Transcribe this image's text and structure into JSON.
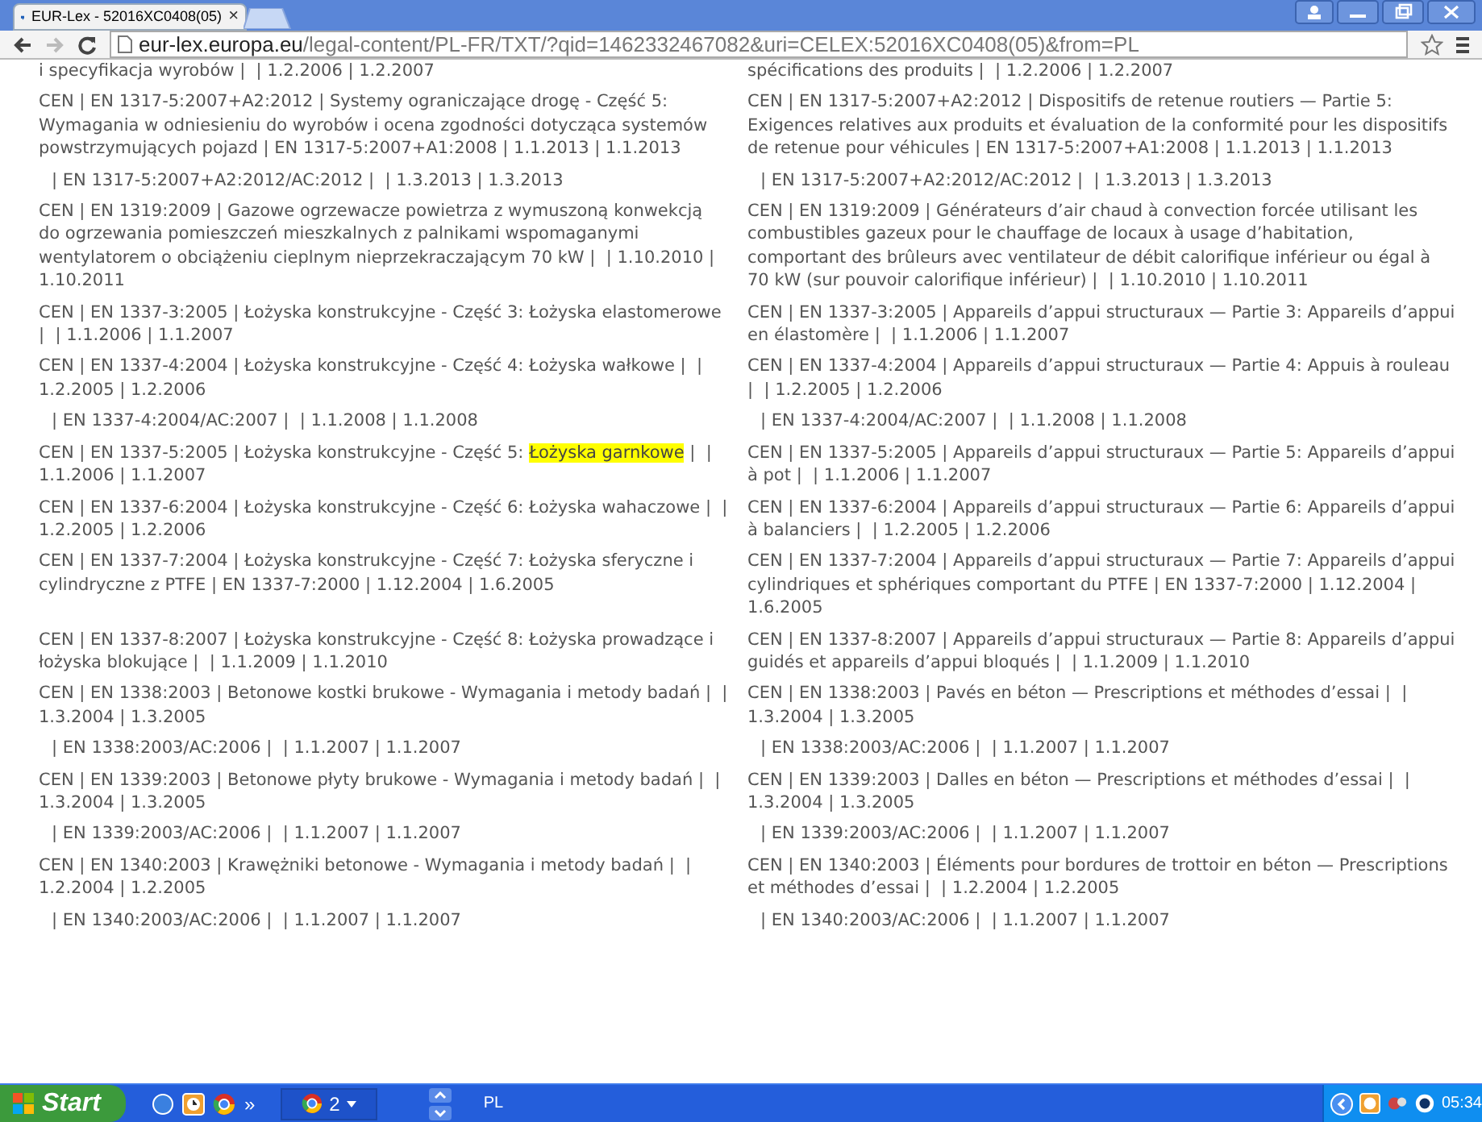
{
  "browser": {
    "tab": {
      "title": "EUR-Lex - 52016XC0408(05)",
      "close": "×",
      "selected": true
    },
    "address": {
      "host": "eur-lex.europa.eu",
      "path": "/legal-content/PL-FR/TXT/?qid=1462332467082&uri=CELEX:52016XC0408(05)&from=PL"
    }
  },
  "rows": [
    {
      "pl": [
        {
          "text": "i specyfikacja wyrobów |  | 1.2.2006 | 1.2.2007",
          "highlighted": false
        }
      ],
      "fr": [
        {
          "text": "spécifications des produits |  | 1.2.2006 | 1.2.2007",
          "highlighted": false
        }
      ]
    },
    {
      "pl": [
        {
          "text": "CEN | EN 1317-5:2007+A2:2012 | Systemy ograniczające drogę - Część 5: Wymagania w odniesieniu do wyrobów i ocena zgodności dotycząca systemów powstrzymujących pojazd | EN 1317-5:2007+A1:2008 | 1.1.2013 | 1.1.2013",
          "highlighted": false
        }
      ],
      "fr": [
        {
          "text": "CEN | EN 1317-5:2007+A2:2012 | Dispositifs de retenue routiers — Partie 5: Exigences relatives aux produits et évaluation de la conformité pour les dispositifs de retenue pour véhicules | EN 1317-5:2007+A1:2008 | 1.1.2013 | 1.1.2013",
          "highlighted": false
        }
      ]
    },
    {
      "pl": [
        {
          "text": "| EN 1317-5:2007+A2:2012/AC:2012 |  | 1.3.2013 | 1.3.2013",
          "highlighted": false
        }
      ],
      "fr": [
        {
          "text": "| EN 1317-5:2007+A2:2012/AC:2012 |  | 1.3.2013 | 1.3.2013",
          "highlighted": false
        }
      ],
      "indent": true
    },
    {
      "pl": [
        {
          "text": "CEN | EN 1319:2009 | Gazowe ogrzewacze powietrza z wymuszoną konwekcją do ogrzewania pomieszczeń mieszkalnych z palnikami wspomaganymi wentylatorem o obciążeniu cieplnym nieprzekraczającym 70 kW |  | 1.10.2010 | 1.10.2011",
          "highlighted": false
        }
      ],
      "fr": [
        {
          "text": "CEN | EN 1319:2009 | Générateurs d’air chaud à convection forcée utilisant les combustibles gazeux pour le chauffage de locaux à usage d’habitation, comportant des brûleurs avec ventilateur de débit calorifique inférieur ou égal à 70 kW (sur pouvoir calorifique inférieur) |  | 1.10.2010 | 1.10.2011",
          "highlighted": false
        }
      ]
    },
    {
      "pl": [
        {
          "text": "CEN | EN 1337-3:2005 | Łożyska konstrukcyjne - Część 3: Łożyska elastomerowe |  | 1.1.2006 | 1.1.2007",
          "highlighted": false
        }
      ],
      "fr": [
        {
          "text": "CEN | EN 1337-3:2005 | Appareils d’appui structuraux — Partie 3: Appareils d’appui en élastomère |  | 1.1.2006 | 1.1.2007",
          "highlighted": false
        }
      ]
    },
    {
      "pl": [
        {
          "text": "CEN | EN 1337-4:2004 | Łożyska konstrukcyjne - Część 4: Łożyska wałkowe |  | 1.2.2005 | 1.2.2006",
          "highlighted": false
        }
      ],
      "fr": [
        {
          "text": "CEN | EN 1337-4:2004 | Appareils d’appui structuraux — Partie 4: Appuis à rouleau |  | 1.2.2005 | 1.2.2006",
          "highlighted": false
        }
      ]
    },
    {
      "pl": [
        {
          "text": "| EN 1337-4:2004/AC:2007 |  | 1.1.2008 | 1.1.2008",
          "highlighted": false
        }
      ],
      "fr": [
        {
          "text": "| EN 1337-4:2004/AC:2007 |  | 1.1.2008 | 1.1.2008",
          "highlighted": false
        }
      ],
      "indent": true
    },
    {
      "pl": [
        {
          "text": "CEN | EN 1337-5:2005 | Łożyska konstrukcyjne - Część 5: ",
          "highlighted": false
        },
        {
          "text": "Łożyska garnkowe",
          "highlighted": true
        },
        {
          "text": " |  | 1.1.2006 | 1.1.2007",
          "highlighted": false
        }
      ],
      "fr": [
        {
          "text": "CEN | EN 1337-5:2005 | Appareils d’appui structuraux — Partie 5: Appareils d’appui à pot |  | 1.1.2006 | 1.1.2007",
          "highlighted": false
        }
      ]
    },
    {
      "pl": [
        {
          "text": "CEN | EN 1337-6:2004 | Łożyska konstrukcyjne - Część 6: Łożyska wahaczowe |  | 1.2.2005 | 1.2.2006",
          "highlighted": false
        }
      ],
      "fr": [
        {
          "text": "CEN | EN 1337-6:2004 | Appareils d’appui structuraux — Partie 6: Appareils d’appui à balanciers |  | 1.2.2005 | 1.2.2006",
          "highlighted": false
        }
      ]
    },
    {
      "pl": [
        {
          "text": "CEN | EN 1337-7:2004 | Łożyska konstrukcyjne - Część 7: Łożyska sferyczne i cylindryczne z PTFE | EN 1337-7:2000 | 1.12.2004 | 1.6.2005",
          "highlighted": false
        }
      ],
      "fr": [
        {
          "text": "CEN | EN 1337-7:2004 | Appareils d’appui structuraux — Partie 7: Appareils d’appui cylindriques et sphériques comportant du PTFE | EN 1337-7:2000 | 1.12.2004 | 1.6.2005",
          "highlighted": false
        }
      ]
    },
    {
      "pl": [
        {
          "text": "CEN | EN 1337-8:2007 | Łożyska konstrukcyjne - Część 8: Łożyska prowadzące i łożyska blokujące |  | 1.1.2009 | 1.1.2010",
          "highlighted": false
        }
      ],
      "fr": [
        {
          "text": "CEN | EN 1337-8:2007 | Appareils d’appui structuraux — Partie 8: Appareils d’appui guidés et appareils d’appui bloqués |  | 1.1.2009 | 1.1.2010",
          "highlighted": false
        }
      ]
    },
    {
      "pl": [
        {
          "text": "CEN | EN 1338:2003 | Betonowe kostki brukowe - Wymagania i metody badań |  | 1.3.2004 | 1.3.2005",
          "highlighted": false
        }
      ],
      "fr": [
        {
          "text": "CEN | EN 1338:2003 | Pavés en béton — Prescriptions et méthodes d’essai |  | 1.3.2004 | 1.3.2005",
          "highlighted": false
        }
      ]
    },
    {
      "pl": [
        {
          "text": "| EN 1338:2003/AC:2006 |  | 1.1.2007 | 1.1.2007",
          "highlighted": false
        }
      ],
      "fr": [
        {
          "text": "| EN 1338:2003/AC:2006 |  | 1.1.2007 | 1.1.2007",
          "highlighted": false
        }
      ],
      "indent": true
    },
    {
      "pl": [
        {
          "text": "CEN | EN 1339:2003 | Betonowe płyty brukowe - Wymagania i metody badań |  | 1.3.2004 | 1.3.2005",
          "highlighted": false
        }
      ],
      "fr": [
        {
          "text": "CEN | EN 1339:2003 | Dalles en béton — Prescriptions et méthodes d’essai |  | 1.3.2004 | 1.3.2005",
          "highlighted": false
        }
      ]
    },
    {
      "pl": [
        {
          "text": "| EN 1339:2003/AC:2006 |  | 1.1.2007 | 1.1.2007",
          "highlighted": false
        }
      ],
      "fr": [
        {
          "text": "| EN 1339:2003/AC:2006 |  | 1.1.2007 | 1.1.2007",
          "highlighted": false
        }
      ],
      "indent": true
    },
    {
      "pl": [
        {
          "text": "CEN | EN 1340:2003 | Krawężniki betonowe - Wymagania i metody badań |  | 1.2.2004 | 1.2.2005",
          "highlighted": false
        }
      ],
      "fr": [
        {
          "text": "CEN | EN 1340:2003 | Éléments pour bordures de trottoir en béton — Prescriptions et méthodes d’essai |  | 1.2.2004 | 1.2.2005",
          "highlighted": false
        }
      ]
    },
    {
      "pl": [
        {
          "text": "| EN 1340:2003/AC:2006 |  | 1.1.2007 | 1.1.2007",
          "highlighted": false
        }
      ],
      "fr": [
        {
          "text": "| EN 1340:2003/AC:2006 |  | 1.1.2007 | 1.1.2007",
          "highlighted": false
        }
      ],
      "indent": true
    }
  ],
  "taskbar": {
    "start": "Start",
    "more": "»",
    "group_count": "2",
    "language": "PL",
    "clock": "05:34"
  }
}
